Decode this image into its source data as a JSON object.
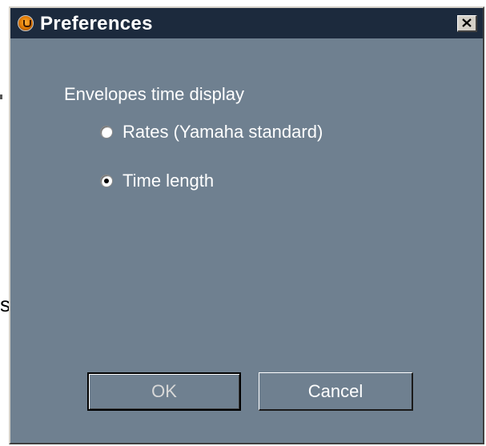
{
  "background": {
    "partial_text": "s"
  },
  "window": {
    "title": "Preferences",
    "icon": "app-logo-icon",
    "close_icon": "close-icon"
  },
  "envelopes": {
    "group_label": "Envelopes time display",
    "options": [
      {
        "label": "Rates (Yamaha standard)",
        "selected": false
      },
      {
        "label": "Time length",
        "selected": true
      }
    ]
  },
  "buttons": {
    "ok_label": "OK",
    "cancel_label": "Cancel"
  },
  "colors": {
    "dialog_bg": "#6f8090",
    "titlebar_bg": "#1c2a3d",
    "text": "#ffffff"
  }
}
